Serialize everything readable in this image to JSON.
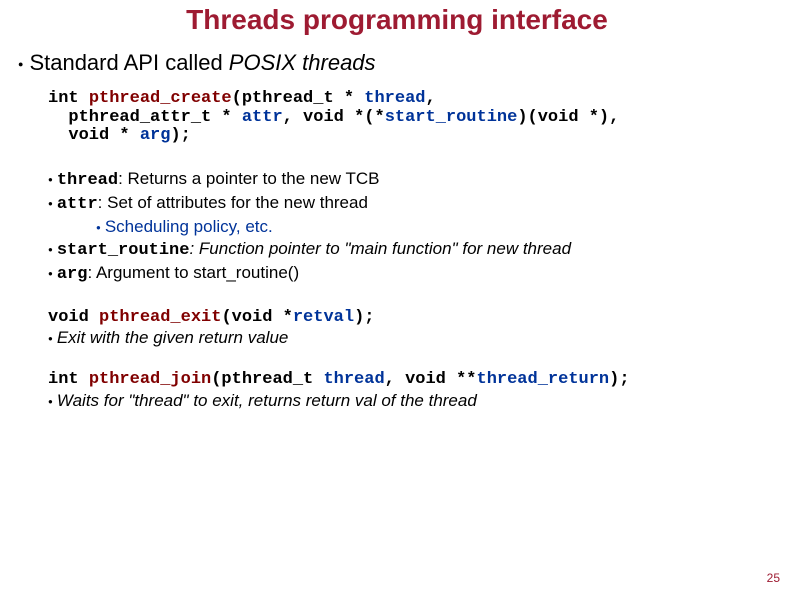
{
  "title": "Threads programming interface",
  "main_bullet_pre": "Standard API called ",
  "main_bullet_italic": "POSIX threads",
  "code1": {
    "line1": {
      "t1": "int ",
      "fn": "pthread_create",
      "t2": "(pthread_t  *  ",
      "p1": "thread",
      "t3": ","
    },
    "line2": {
      "t1": "pthread_attr_t * ",
      "p1": "attr",
      "t2": ", void *(*",
      "p2": "start_routine",
      "t3": ")(void *),"
    },
    "line3": {
      "t1": "void * ",
      "p1": "arg",
      "t2": ");"
    }
  },
  "params": {
    "thread": {
      "name": "thread",
      "desc": ": Returns a pointer to the new TCB"
    },
    "attr": {
      "name": "attr",
      "desc": ": Set of attributes for the new thread"
    },
    "attr_sub": "Scheduling policy, etc.",
    "start_routine": {
      "name": "start_routine",
      "desc": ": Function pointer to \"main function\" for new thread"
    },
    "arg": {
      "name": "arg",
      "desc": ": Argument to start_routine()"
    }
  },
  "code2": {
    "t1": "void ",
    "fn": "pthread_exit",
    "t2": "(void *",
    "p1": "retval",
    "t3": ");"
  },
  "exit_desc": "Exit with the given return value",
  "code3": {
    "t1": "int ",
    "fn": "pthread_join",
    "t2": "(pthread_t ",
    "p1": "thread",
    "t3": ", void **",
    "p2": "thread_return",
    "t4": ");"
  },
  "join_desc": "Waits for \"thread\" to exit, returns return val of the thread",
  "page": "25"
}
